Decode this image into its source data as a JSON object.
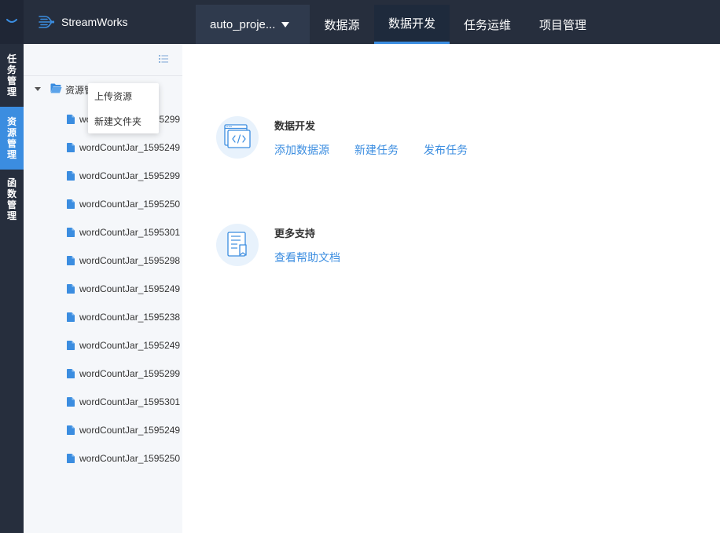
{
  "app": {
    "brand_name": "StreamWorks",
    "accent_color": "#3b8de0",
    "nav_bg": "#262e3d"
  },
  "header": {
    "project_selector": "auto_proje...",
    "tabs": [
      {
        "label": "数据源",
        "active": false
      },
      {
        "label": "数据开发",
        "active": true
      },
      {
        "label": "任务运维",
        "active": false
      },
      {
        "label": "项目管理",
        "active": false
      }
    ]
  },
  "left_nav": {
    "items": [
      {
        "chars": [
          "任",
          "务",
          "管",
          "理"
        ],
        "active": false
      },
      {
        "chars": [
          "资",
          "源",
          "管",
          "理"
        ],
        "active": true
      },
      {
        "chars": [
          "函",
          "数",
          "管",
          "理"
        ],
        "active": false
      }
    ]
  },
  "tree": {
    "root_label": "资源管",
    "files": [
      "wordCountJar_1595299",
      "wordCountJar_1595249",
      "wordCountJar_1595299",
      "wordCountJar_1595250",
      "wordCountJar_1595301",
      "wordCountJar_1595298",
      "wordCountJar_1595249",
      "wordCountJar_1595238",
      "wordCountJar_1595249",
      "wordCountJar_1595299",
      "wordCountJar_1595301",
      "wordCountJar_1595249",
      "wordCountJar_1595250"
    ]
  },
  "context_menu": {
    "items": [
      "上传资源",
      "新建文件夹"
    ]
  },
  "main": {
    "sections": [
      {
        "title": "数据开发",
        "icon": "code-window-icon",
        "links": [
          "添加数据源",
          "新建任务",
          "发布任务"
        ]
      },
      {
        "title": "更多支持",
        "icon": "help-document-icon",
        "links": [
          "查看帮助文档"
        ]
      }
    ]
  }
}
